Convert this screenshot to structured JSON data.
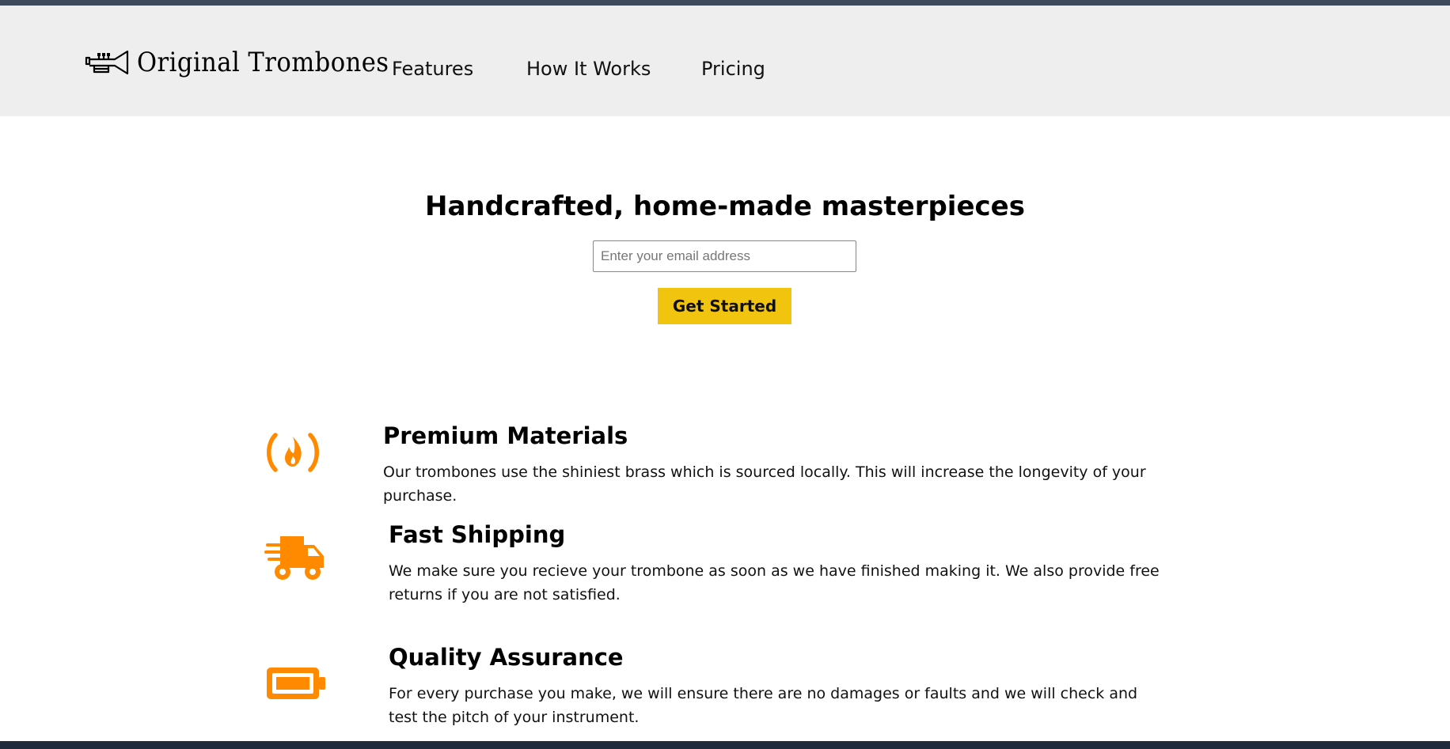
{
  "brand": {
    "name": "Original Trombones",
    "logo_icon": "trumpet-icon"
  },
  "nav": {
    "items": [
      {
        "label": "Features"
      },
      {
        "label": "How It Works"
      },
      {
        "label": "Pricing"
      }
    ]
  },
  "hero": {
    "title": "Handcrafted, home-made masterpieces",
    "email_placeholder": "Enter your email address",
    "email_value": "",
    "cta_label": "Get Started"
  },
  "features": [
    {
      "icon": "free-code-camp-fire-icon",
      "title": "Premium Materials",
      "description": "Our trombones use the shiniest brass which is sourced locally. This will increase the longevity of your purchase."
    },
    {
      "icon": "shipping-truck-icon",
      "title": "Fast Shipping",
      "description": "We make sure you recieve your trombone as soon as we have finished making it. We also provide free returns if you are not satisfied."
    },
    {
      "icon": "battery-full-icon",
      "title": "Quality Assurance",
      "description": "For every purchase you make, we will ensure there are no damages or faults and we will check and test the pitch of your instrument."
    }
  ],
  "colors": {
    "header_bg": "#eeeeee",
    "cta_bg": "#f1c40f",
    "icon_orange": "#ff8a00"
  }
}
